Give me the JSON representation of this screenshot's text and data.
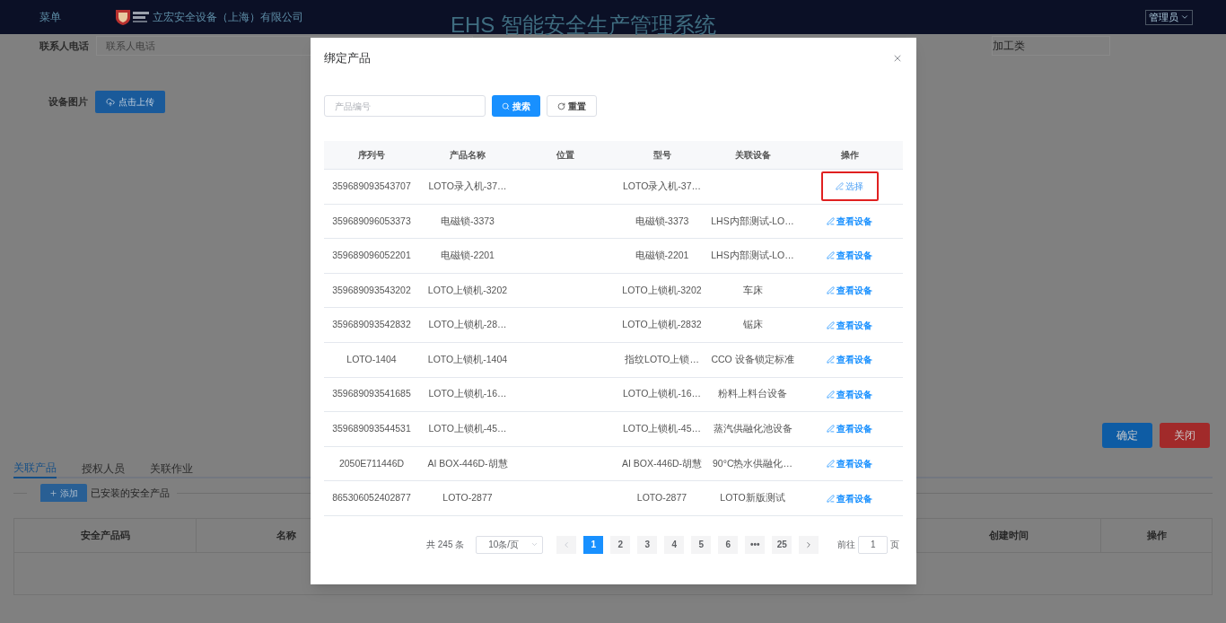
{
  "header": {
    "menu": "菜单",
    "company": "立宏安全设备（上海）有限公司",
    "system_title": "EHS 智能安全生产管理系统",
    "user": "管理员"
  },
  "form": {
    "contact_label": "联系人电话",
    "contact_placeholder": "联系人电话",
    "category_value": "加工类",
    "image_label": "设备图片",
    "upload_button": "点击上传"
  },
  "actions": [
    "确定",
    "关闭"
  ],
  "tabs": [
    {
      "label": "关联产品",
      "selected": true
    },
    {
      "label": "授权人员",
      "selected": false
    },
    {
      "label": "关联作业",
      "selected": false
    }
  ],
  "section": {
    "add_button": "添加",
    "title": "已安装的安全产品"
  },
  "table": {
    "columns": [
      "安全产品码",
      "名称",
      "创建时间",
      "操作"
    ]
  },
  "dialog": {
    "title": "绑定产品",
    "search_placeholder": "产品编号",
    "search_button": "搜索",
    "reset_button": "重置",
    "columns": [
      "序列号",
      "产品名称",
      "位置",
      "型号",
      "关联设备",
      "操作"
    ],
    "rows": [
      {
        "serial": "359689093543707",
        "name": "LOTO录入机-37…",
        "model": "LOTO录入机-37…",
        "device": "",
        "action": {
          "label": "选择",
          "kind": "select",
          "highlighted": true
        }
      },
      {
        "serial": "359689096053373",
        "name": "电磁锁-3373",
        "model": "电磁锁-3373",
        "device": "LHS内部测试-LO…",
        "action": {
          "label": "查看设备",
          "kind": "view",
          "highlighted": false
        }
      },
      {
        "serial": "359689096052201",
        "name": "电磁锁-2201",
        "model": "电磁锁-2201",
        "device": "LHS内部测试-LO…",
        "action": {
          "label": "查看设备",
          "kind": "view",
          "highlighted": false
        }
      },
      {
        "serial": "359689093543202",
        "name": "LOTO上锁机-3202",
        "model": "LOTO上锁机-3202",
        "device": "车床",
        "action": {
          "label": "查看设备",
          "kind": "view",
          "highlighted": false
        }
      },
      {
        "serial": "359689093542832",
        "name": "LOTO上锁机-28…",
        "model": "LOTO上锁机-2832",
        "device": "锯床",
        "action": {
          "label": "查看设备",
          "kind": "view",
          "highlighted": false
        }
      },
      {
        "serial": "LOTO-1404",
        "name": "LOTO上锁机-1404",
        "model": "指纹LOTO上锁…",
        "device": "CCO 设备锁定标准",
        "action": {
          "label": "查看设备",
          "kind": "view",
          "highlighted": false
        }
      },
      {
        "serial": "359689093541685",
        "name": "LOTO上锁机-16…",
        "model": "LOTO上锁机-16…",
        "device": "粉料上料台设备",
        "action": {
          "label": "查看设备",
          "kind": "view",
          "highlighted": false
        }
      },
      {
        "serial": "359689093544531",
        "name": "LOTO上锁机-45…",
        "model": "LOTO上锁机-45…",
        "device": "蒸汽供融化池设备",
        "action": {
          "label": "查看设备",
          "kind": "view",
          "highlighted": false
        }
      },
      {
        "serial": "2050E711446D",
        "name": "AI BOX-446D-胡慧",
        "model": "AI BOX-446D-胡慧",
        "device": "90°C热水供融化…",
        "action": {
          "label": "查看设备",
          "kind": "view",
          "highlighted": false
        }
      },
      {
        "serial": "865306052402877",
        "name": "LOTO-2877",
        "model": "LOTO-2877",
        "device": "LOTO新版测试",
        "action": {
          "label": "查看设备",
          "kind": "view",
          "highlighted": false
        }
      }
    ],
    "pagination": {
      "total": "共 245 条",
      "page_size": "10条/页",
      "pages": [
        {
          "label": "1",
          "selected": true
        },
        {
          "label": "2",
          "selected": false
        },
        {
          "label": "3",
          "selected": false
        },
        {
          "label": "4",
          "selected": false
        },
        {
          "label": "5",
          "selected": false
        },
        {
          "label": "6",
          "selected": false
        },
        {
          "label": "•••",
          "selected": false
        },
        {
          "label": "25",
          "selected": false
        }
      ],
      "goto_label": "前往",
      "goto_value": "1",
      "page_suffix": "页"
    }
  }
}
